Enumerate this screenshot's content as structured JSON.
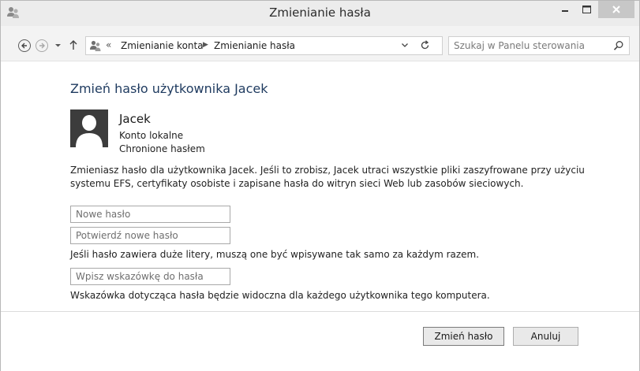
{
  "window": {
    "title": "Zmienianie hasła"
  },
  "address_bar": {
    "separator": "«",
    "crumbs": [
      "Zmienianie konta",
      "Zmienianie hasła"
    ]
  },
  "search": {
    "placeholder": "Szukaj w Panelu sterowania"
  },
  "main": {
    "heading": "Zmień hasło użytkownika Jacek",
    "user": {
      "name": "Jacek",
      "account_type": "Konto lokalne",
      "protection": "Chronione hasłem"
    },
    "description": "Zmieniasz hasło dla użytkownika Jacek. Jeśli to zrobisz, Jacek utraci wszystkie pliki zaszyfrowane przy użyciu systemu EFS, certyfikaty osobiste i zapisane hasła do witryn sieci Web lub zasobów sieciowych.",
    "fields": {
      "new_password_placeholder": "Nowe hasło",
      "confirm_password_placeholder": "Potwierdź nowe hasło",
      "hint_placeholder": "Wpisz wskazówkę do hasła"
    },
    "case_note": "Jeśli hasło zawiera duże litery, muszą one być wpisywane tak samo za każdym razem.",
    "hint_note": "Wskazówka dotycząca hasła będzie widoczna dla każdego użytkownika tego komputera."
  },
  "footer": {
    "change_label": "Zmień hasło",
    "cancel_label": "Anuluj"
  },
  "icons": {
    "title": "users-icon",
    "back": "arrow-left-icon",
    "forward": "arrow-right-icon",
    "recent": "chevron-down-icon",
    "up": "arrow-up-icon",
    "address": "users-icon",
    "dropdown": "chevron-down-icon",
    "refresh": "refresh-icon",
    "search": "search-icon",
    "minimize": "minimize-icon",
    "maximize": "maximize-icon",
    "close": "close-icon"
  },
  "colors": {
    "titlebar": "#ececec",
    "navbar": "#f3f3f3",
    "heading": "#1e3a5f",
    "close_button": "#c7c7c7",
    "avatar": "#3c3c3c"
  }
}
